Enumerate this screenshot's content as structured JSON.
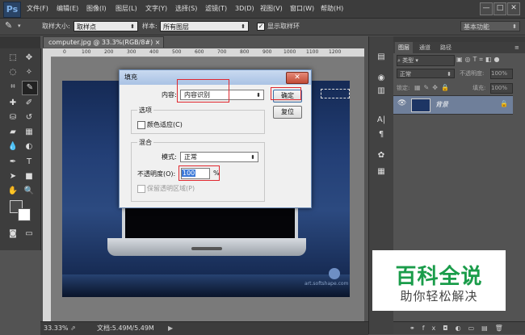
{
  "app": {
    "logo": "Ps"
  },
  "menu": [
    "文件(F)",
    "编辑(E)",
    "图像(I)",
    "图层(L)",
    "文字(Y)",
    "选择(S)",
    "滤镜(T)",
    "3D(D)",
    "视图(V)",
    "窗口(W)",
    "帮助(H)"
  ],
  "window_controls": {
    "minimize": "—",
    "restore": "□",
    "close": "✕"
  },
  "options_bar": {
    "sample_size_label": "取样大小:",
    "sample_size_value": "取样点",
    "sample_label": "样本:",
    "sample_value": "所有图层",
    "show_ring_label": "显示取样环",
    "workspace": "基本功能"
  },
  "document": {
    "tab_title": "computer.jpg @ 33.3%(RGB/8#)",
    "ruler_ticks": [
      "0",
      "100",
      "200",
      "300",
      "400",
      "500",
      "600",
      "700",
      "800",
      "900",
      "1000",
      "1100",
      "1200"
    ],
    "watermark": "art.softshape.com"
  },
  "status": {
    "zoom": "33.33%",
    "doc": "文档:5.49M/5.49M"
  },
  "dialog": {
    "title": "填充",
    "content_label": "内容:",
    "content_value": "内容识别",
    "ok": "确定",
    "reset": "复位",
    "options_title": "选项",
    "color_adapt": "颜色适应(C)",
    "blend_title": "混合",
    "mode_label": "模式:",
    "mode_value": "正常",
    "opacity_label": "不透明度(O):",
    "opacity_value": "100",
    "opacity_unit": "%",
    "preserve": "保留透明区域(P)"
  },
  "layers": {
    "tabs": [
      "图层",
      "通道",
      "路径"
    ],
    "filter_label": "类型",
    "blend_mode": "正常",
    "opacity_label": "不透明度:",
    "opacity_value": "100%",
    "lock_label": "锁定:",
    "fill_label": "填充:",
    "fill_value": "100%",
    "layer_name": "背景"
  },
  "banner": {
    "title": "百科全说",
    "subtitle": "助你轻松解决"
  }
}
